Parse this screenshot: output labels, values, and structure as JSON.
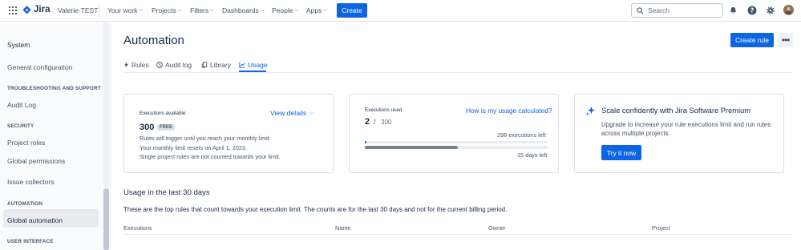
{
  "topbar": {
    "product": "Jira",
    "site": "Valerie-TEST",
    "nav": [
      {
        "label": "Your work"
      },
      {
        "label": "Projects"
      },
      {
        "label": "Filters"
      },
      {
        "label": "Dashboards"
      },
      {
        "label": "People"
      },
      {
        "label": "Apps"
      }
    ],
    "create_label": "Create",
    "search_placeholder": "Search"
  },
  "sidebar": {
    "title": "System",
    "general": "General configuration",
    "sections": {
      "troubleshooting": "TROUBLESHOOTING AND SUPPORT",
      "security": "SECURITY",
      "automation": "AUTOMATION",
      "ui": "USER INTERFACE"
    },
    "items": {
      "audit_log": "Audit Log",
      "project_roles": "Project roles",
      "global_permissions": "Global permissions",
      "issue_collectors": "Issue collectors",
      "global_automation": "Global automation"
    }
  },
  "page": {
    "title": "Automation",
    "create_rule": "Create rule",
    "more": "•••",
    "tabs": [
      {
        "label": "Rules",
        "icon": "bolt-icon"
      },
      {
        "label": "Audit log",
        "icon": "clock-icon"
      },
      {
        "label": "Library",
        "icon": "copy-icon"
      },
      {
        "label": "Usage",
        "icon": "chart-icon",
        "active": true
      }
    ]
  },
  "cards": {
    "available": {
      "label": "Executions available",
      "view_details": "View details",
      "amount": "300",
      "badge": "FREE",
      "line1": "Rules will trigger until you reach your monthly limit.",
      "line2": "Your monthly limit resets on April 1, 2023.",
      "line3": "Single project rules are not counted towards your limit."
    },
    "used": {
      "label": "Executions used",
      "link": "How is my usage calculated?",
      "used": "2",
      "slash": "/",
      "limit": "300",
      "left": "298 executions left",
      "days": "15 days left",
      "usage_fraction": 0.007,
      "time_fraction": 0.51
    },
    "premium": {
      "title": "Scale confidently with Jira Software Premium",
      "body1": "Upgrade to increase your rule executions limit and run rules",
      "body2": "across multiple projects.",
      "button": "Try it now"
    }
  },
  "usage": {
    "heading": "Usage in the last 30 days",
    "description": "These are the top rules that count towards your execution limit. The counts are for the last 30 days and not for the current billing period.",
    "columns": [
      "Executions",
      "Name",
      "Owner",
      "Project"
    ]
  },
  "colors": {
    "brand": "#0c66e4",
    "bar_used": "#0c66e4",
    "bar_time": "#758195"
  }
}
